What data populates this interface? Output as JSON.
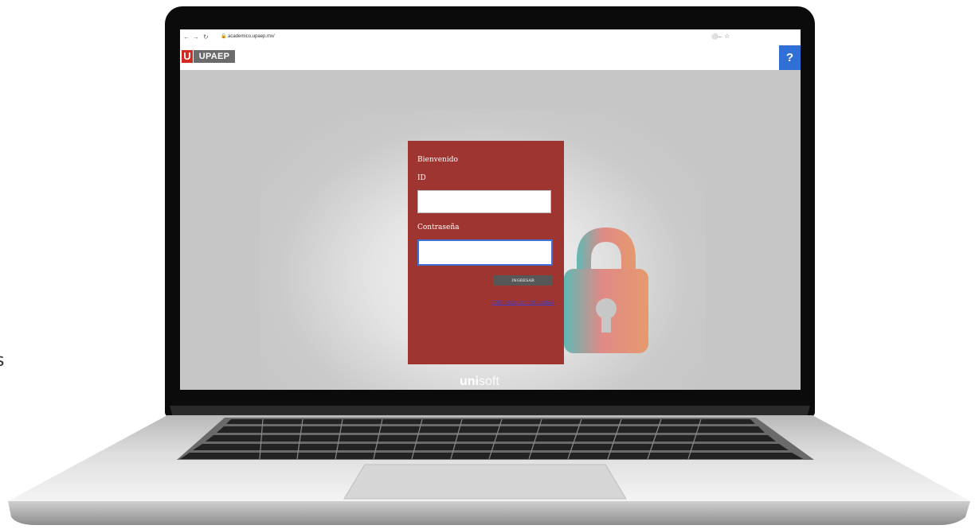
{
  "edge_text": "s",
  "browser": {
    "url": "academico.upaep.mx/"
  },
  "header": {
    "logo_letter": "U",
    "logo_word": "UPAEP",
    "help_label": "?"
  },
  "login": {
    "welcome": "Bienvenido",
    "id_label": "ID",
    "id_value": "",
    "password_label": "Contraseña",
    "password_value": "",
    "submit_label": "INGRESAR",
    "forgot_link": "¿Olvidaste tu contraseña?"
  },
  "footer": {
    "brand_bold": "uni",
    "brand_light": "soft"
  },
  "colors": {
    "card": "#9e3530",
    "help_button": "#2f6fd6",
    "logo_red": "#d32a1f",
    "logo_gray": "#6b6b6b",
    "submit_button": "#575757",
    "link": "#3b3fd4"
  },
  "icons": [
    "back-arrow-icon",
    "forward-arrow-icon",
    "reload-icon",
    "lock-icon",
    "key-icon",
    "star-icon",
    "padlock-icon"
  ]
}
